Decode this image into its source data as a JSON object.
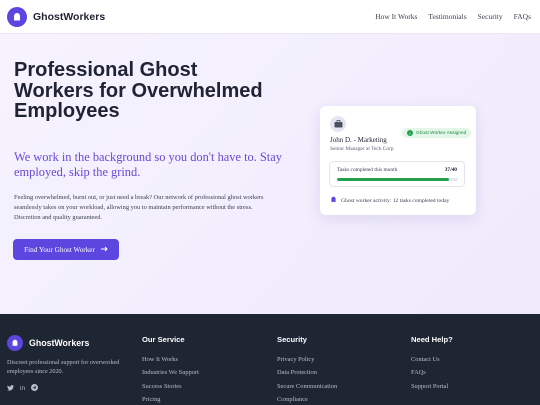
{
  "brand": {
    "name": "GhostWorkers",
    "accent": "#5b47e0"
  },
  "nav": {
    "links": [
      "How It Works",
      "Testimonials",
      "Security",
      "FAQs"
    ]
  },
  "hero": {
    "title": "Professional Ghost Workers for Overwhelmed Employees",
    "subtitle": "We work in the background so you don't have to. Stay employed, skip the grind.",
    "description": "Feeling overwhelmed, burnt out, or just need a break? Our network of professional ghost workers seamlessly takes on your workload, allowing you to maintain performance without the stress. Discretion and quality guaranteed.",
    "cta": "Find Your Ghost Worker"
  },
  "card": {
    "name": "John D. - Marketing",
    "role": "Senior Manager at Tech Corp",
    "badge": "Ghost Worker Assigned",
    "task_label": "Tasks completed this month",
    "task_count": "37/40",
    "progress": 0.925,
    "activity": "Ghost worker activity: 12 tasks completed today"
  },
  "footer": {
    "brand": "GhostWorkers",
    "description": "Discreet professional support for overworked employees since 2020.",
    "social": [
      "twitter-icon",
      "linkedin-icon",
      "telegram-icon"
    ],
    "columns": [
      {
        "title": "Our Service",
        "links": [
          "How It Works",
          "Industries We Support",
          "Success Stories",
          "Pricing"
        ]
      },
      {
        "title": "Security",
        "links": [
          "Privacy Policy",
          "Data Protection",
          "Secure Communication",
          "Compliance"
        ]
      },
      {
        "title": "Need Help?",
        "links": [
          "Contact Us",
          "FAQs",
          "Support Portal"
        ]
      }
    ]
  }
}
